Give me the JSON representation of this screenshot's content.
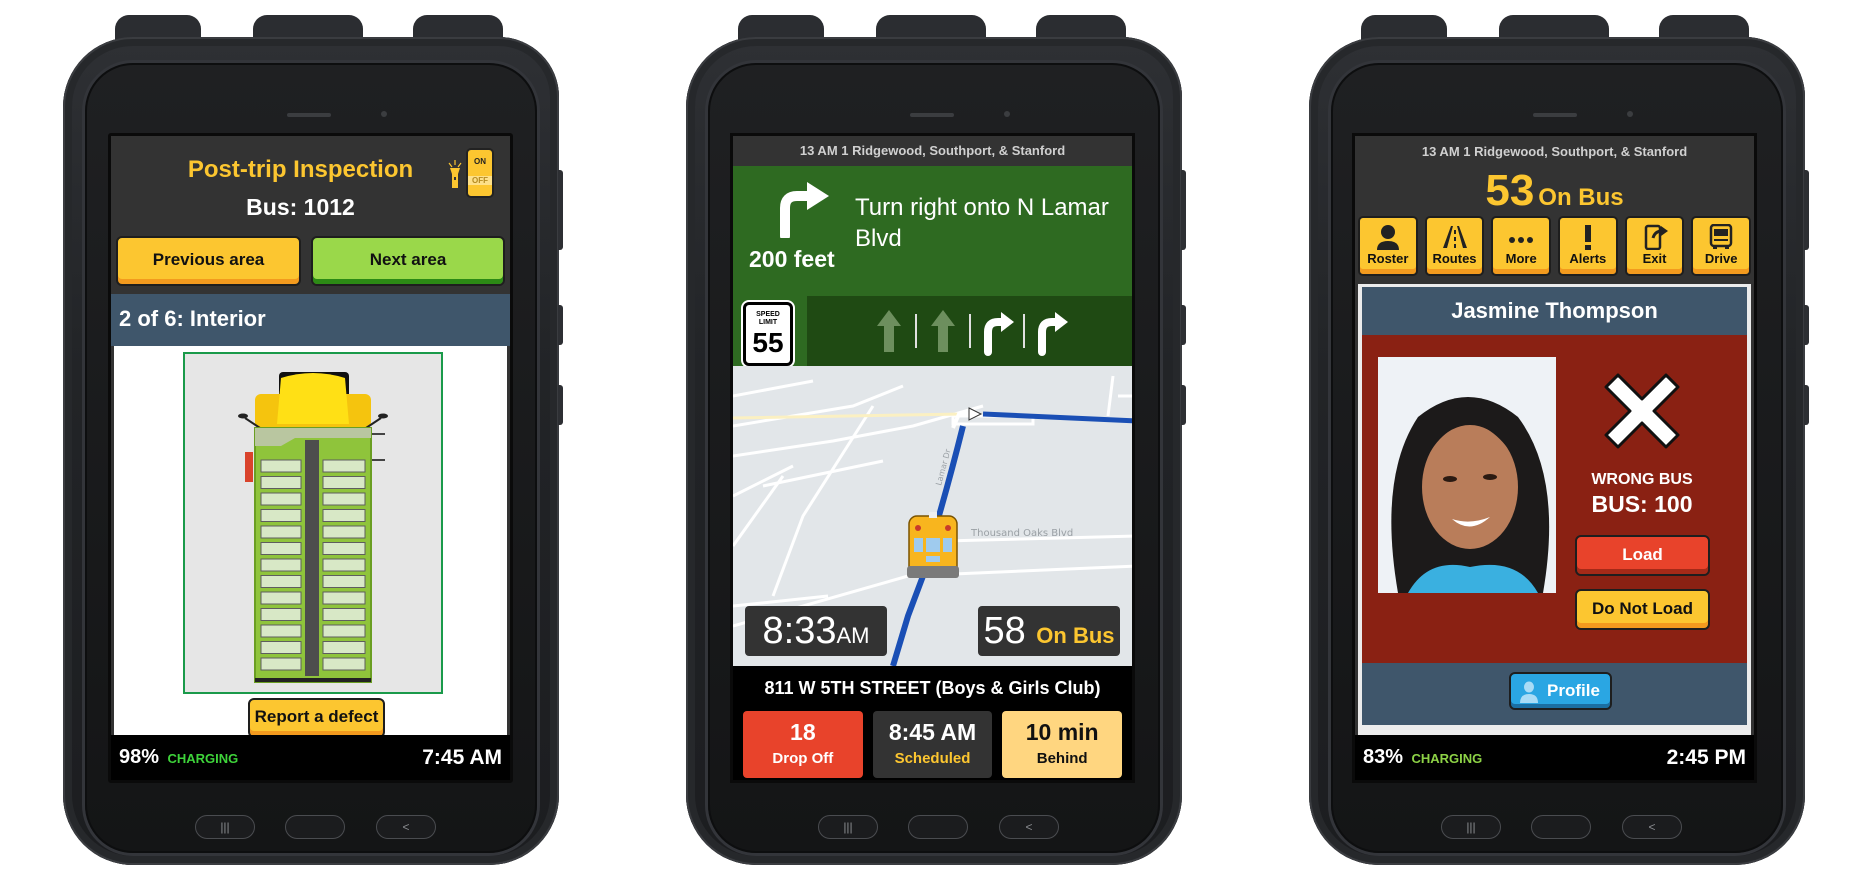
{
  "hardware_buttons": {
    "recents": "|||",
    "back": "<"
  },
  "inspection_screen": {
    "title": "Post-trip Inspection",
    "bus": "Bus: 1012",
    "flashlight_toggle": {
      "on_label": "ON",
      "off_label": "OFF",
      "state": "on"
    },
    "previous_button": "Previous area",
    "next_button": "Next area",
    "area_header": "2 of 6: Interior",
    "report_button": "Report a defect",
    "status": {
      "battery": "98%",
      "charging": "CHARGING",
      "time": "7:45 AM"
    },
    "colors": {
      "accent_yellow": "#fcc630",
      "next_green": "#9ad84a",
      "header_slate": "#3f566b"
    }
  },
  "navigation_screen": {
    "route": "13 AM 1 Ridgewood, Southport, & Stanford",
    "turn_instruction": "Turn right onto N Lamar Blvd",
    "turn_distance": "200 feet",
    "turn_icon": "turn-right-icon",
    "speed_limit": {
      "label_1": "SPEED",
      "label_2": "LIMIT",
      "value": "55"
    },
    "lanes": [
      {
        "icon": "straight-arrow-icon",
        "active": false
      },
      {
        "icon": "straight-arrow-icon",
        "active": false
      },
      {
        "icon": "turn-right-icon",
        "active": true
      },
      {
        "icon": "turn-right-icon",
        "active": true
      }
    ],
    "map_labels": {
      "street_1": "Thousand Oaks Blvd",
      "street_2": "Lamar Dr"
    },
    "current_time": {
      "time": "8:33",
      "ampm": "AM"
    },
    "on_bus": {
      "count": "58",
      "label": "On Bus"
    },
    "stop_address": "811 W 5TH STREET (Boys & Girls Club)",
    "stop_cards": [
      {
        "big": "18",
        "small": "Drop Off"
      },
      {
        "big": "8:45 AM",
        "small": "Scheduled"
      },
      {
        "big": "10 min",
        "small": "Behind"
      }
    ],
    "colors": {
      "nav_green": "#2e6a21",
      "route_blue": "#1a4fb5",
      "drop_red": "#e8432b",
      "behind_yellow": "#ffd680"
    }
  },
  "roster_screen": {
    "route": "13 AM 1 Ridgewood, Southport, & Stanford",
    "on_bus_count": "53",
    "on_bus_label": "On Bus",
    "toolbar": [
      {
        "label": "Roster",
        "icon": "person-icon"
      },
      {
        "label": "Routes",
        "icon": "road-icon"
      },
      {
        "label": "More",
        "icon": "ellipsis-icon"
      },
      {
        "label": "Alerts",
        "icon": "exclamation-icon"
      },
      {
        "label": "Exit",
        "icon": "phone-exit-icon"
      },
      {
        "label": "Drive",
        "icon": "bus-icon"
      }
    ],
    "student_name": "Jasmine Thompson",
    "warning": "WRONG BUS",
    "assigned_bus": "BUS: 100",
    "load_button": "Load",
    "do_not_load_button": "Do Not Load",
    "profile_button": "Profile",
    "status": {
      "battery": "83%",
      "charging": "CHARGING",
      "time": "2:45 PM"
    },
    "colors": {
      "alert_red": "#8a2113",
      "load_red": "#e8432b",
      "profile_blue": "#2aa6e3"
    }
  }
}
